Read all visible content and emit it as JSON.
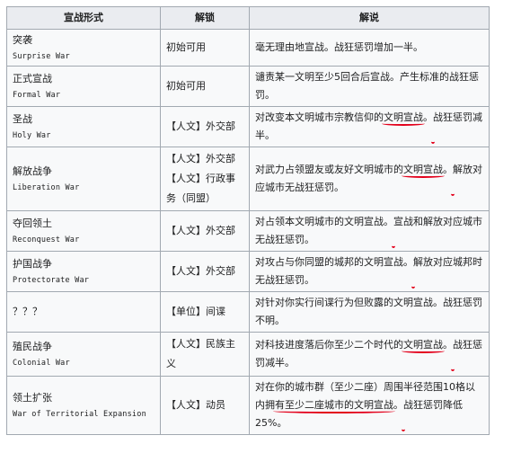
{
  "header": {
    "col1": "宣战形式",
    "col2": "解锁",
    "col3": "解说"
  },
  "rows": [
    {
      "zh": "突袭",
      "en": "Surprise War",
      "unlock": [
        "初始可用"
      ],
      "desc": [
        {
          "t": "毫无理由地宣战。战狂惩罚增加一半。",
          "hl": false
        }
      ]
    },
    {
      "zh": "正式宣战",
      "en": "Formal War",
      "unlock": [
        "初始可用"
      ],
      "desc": [
        {
          "t": "谴责某一文明至少5回合后宣战。产生标准的战狂惩罚。",
          "hl": false
        }
      ]
    },
    {
      "zh": "圣战",
      "en": "Holy War",
      "unlock": [
        "【人文】外交部"
      ],
      "desc": [
        {
          "t": "对改变本文明城市宗教信仰的",
          "hl": false
        },
        {
          "t": "文明宣战",
          "hl": true
        },
        {
          "t": "。",
          "hl": false
        },
        {
          "t": "战狂惩罚减半",
          "hl": true
        },
        {
          "t": "。",
          "hl": false
        }
      ]
    },
    {
      "zh": "解放战争",
      "en": "Liberation War",
      "unlock": [
        "【人文】外交部",
        "【人文】行政事务（同盟）"
      ],
      "desc": [
        {
          "t": "对武力占领盟友或友好文明城市的",
          "hl": false
        },
        {
          "t": "文明宣战",
          "hl": true
        },
        {
          "t": "。",
          "hl": false
        },
        {
          "t": "解放对应城市无战狂惩罚",
          "hl": true
        },
        {
          "t": "。",
          "hl": false
        }
      ]
    },
    {
      "zh": "夺回领土",
      "en": "Reconquest War",
      "unlock": [
        "【人文】外交部"
      ],
      "desc": [
        {
          "t": "对占领本文明城市的文明宣战。",
          "hl": false
        },
        {
          "t": "宣战和解放对应城市无战狂惩罚",
          "hl": true
        },
        {
          "t": "。",
          "hl": false
        }
      ]
    },
    {
      "zh": "护国战争",
      "en": "Protectorate War",
      "unlock": [
        "【人文】外交部"
      ],
      "desc": [
        {
          "t": "对攻占与你同盟的城邦的文明宣战。",
          "hl": false
        },
        {
          "t": "解放对应城邦时无战狂惩罚",
          "hl": true
        },
        {
          "t": "。",
          "hl": false
        }
      ]
    },
    {
      "zh": "？？？",
      "en": "",
      "unlock": [
        "【单位】间谍"
      ],
      "desc": [
        {
          "t": "对针对你实行间谍行为但败露的文明宣战。战狂惩罚不明。",
          "hl": false
        }
      ]
    },
    {
      "zh": "殖民战争",
      "en": "Colonial War",
      "unlock": [
        "【人文】民族主义"
      ],
      "desc": [
        {
          "t": "对科技进度落后你至少二个时代的",
          "hl": false
        },
        {
          "t": "文明宣战",
          "hl": true
        },
        {
          "t": "。",
          "hl": false
        },
        {
          "t": "战狂惩罚减半",
          "hl": true
        },
        {
          "t": "。",
          "hl": false
        }
      ]
    },
    {
      "zh": "领土扩张",
      "en": "War of Territorial Expansion",
      "unlock": [
        "【人文】动员"
      ],
      "desc": [
        {
          "t": "对在你的城市群（至少二座）周围半径范围10格以内拥",
          "hl": false
        },
        {
          "t": "有至少二座城市的文明宣战",
          "hl": true
        },
        {
          "t": "。",
          "hl": false
        },
        {
          "t": "战狂惩罚降低25%",
          "hl": true
        },
        {
          "t": "。",
          "hl": false
        }
      ]
    }
  ]
}
